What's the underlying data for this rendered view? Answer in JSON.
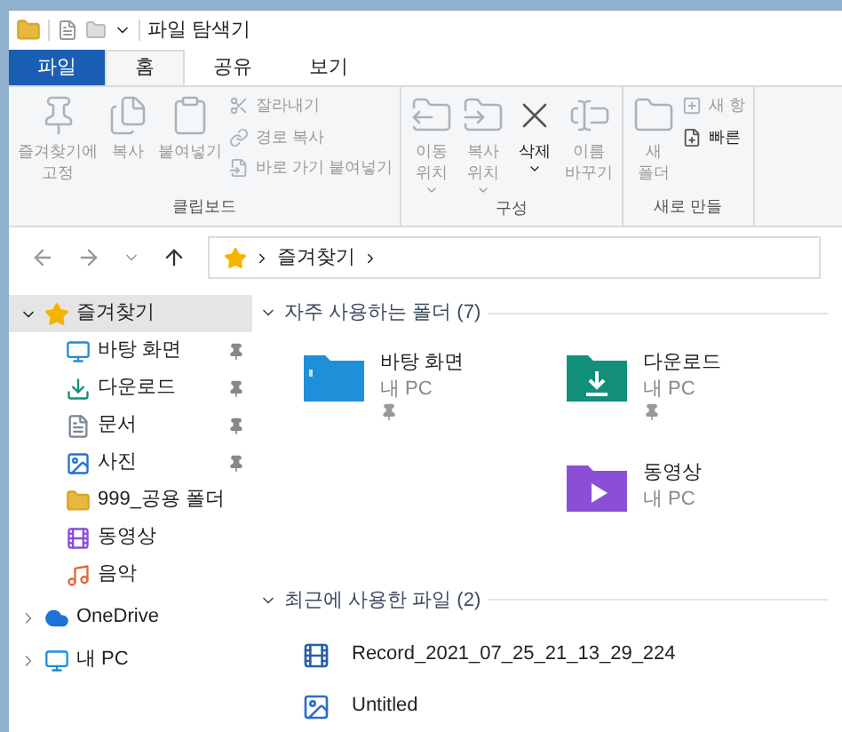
{
  "window": {
    "title": "파일 탐색기"
  },
  "tabs": [
    {
      "label": "파일",
      "kind": "file",
      "selected": false
    },
    {
      "label": "홈",
      "kind": "tab",
      "selected": true
    },
    {
      "label": "공유",
      "kind": "tab",
      "selected": false
    },
    {
      "label": "보기",
      "kind": "tab",
      "selected": false
    }
  ],
  "ribbon_groups": [
    {
      "label": "클립보드",
      "items": [
        {
          "kind": "large",
          "label": "즐겨찾기에\n고정",
          "disabled": true,
          "dropdown": false
        },
        {
          "kind": "large",
          "label": "복사",
          "disabled": true,
          "dropdown": false
        },
        {
          "kind": "large",
          "label": "붙여넣기",
          "disabled": true,
          "dropdown": false
        },
        {
          "kind": "small_stack",
          "rows": [
            {
              "label": "잘라내기",
              "disabled": true
            },
            {
              "label": "경로 복사",
              "disabled": true
            },
            {
              "label": "바로 가기 붙여넣기",
              "disabled": true
            }
          ]
        }
      ]
    },
    {
      "label": "구성",
      "items": [
        {
          "kind": "large",
          "label": "이동\n위치",
          "disabled": true,
          "dropdown": true
        },
        {
          "kind": "large",
          "label": "복사\n위치",
          "disabled": true,
          "dropdown": true
        },
        {
          "kind": "large",
          "label": "삭제",
          "disabled": false,
          "dropdown": true
        },
        {
          "kind": "large",
          "label": "이름\n바꾸기",
          "disabled": true,
          "dropdown": false
        }
      ]
    },
    {
      "label": "새로 만들",
      "items": [
        {
          "kind": "large",
          "label": "새\n폴더",
          "disabled": true,
          "dropdown": false
        },
        {
          "kind": "small_stack",
          "rows": [
            {
              "label": "새 항",
              "disabled": true
            },
            {
              "label": "빠른",
              "disabled": false
            }
          ]
        }
      ]
    }
  ],
  "address_bar": {
    "crumbs": [
      "즐겨찾기"
    ]
  },
  "sidebar": {
    "items": [
      {
        "label": "즐겨찾기",
        "expanded": true,
        "selected": true,
        "children": [
          {
            "label": "바탕 화면",
            "pinned": true
          },
          {
            "label": "다운로드",
            "pinned": true
          },
          {
            "label": "문서",
            "pinned": true
          },
          {
            "label": "사진",
            "pinned": true
          },
          {
            "label": "999_공용 폴더",
            "pinned": false
          },
          {
            "label": "동영상",
            "pinned": false
          },
          {
            "label": "음악",
            "pinned": false
          }
        ]
      },
      {
        "label": "OneDrive",
        "expanded": false,
        "selected": false
      },
      {
        "label": "내 PC",
        "expanded": false,
        "selected": false
      }
    ]
  },
  "frequent_folders": {
    "heading": "자주 사용하는 폴더 (7)",
    "expanded": true,
    "items": [
      {
        "kind": "folder",
        "name": "바탕 화면",
        "location": "내 PC",
        "pinned": true
      },
      {
        "kind": "folder",
        "name": "다운로드",
        "location": "내 PC",
        "pinned": true
      },
      {
        "kind": "empty"
      },
      {
        "kind": "folder",
        "name": "동영상",
        "location": "내 PC",
        "pinned": false
      }
    ]
  },
  "recent_files": {
    "heading": "최근에 사용한 파일 (2)",
    "expanded": true,
    "items": [
      {
        "name": "Record_2021_07_25_21_13_29_224"
      },
      {
        "name": "Untitled"
      }
    ]
  }
}
